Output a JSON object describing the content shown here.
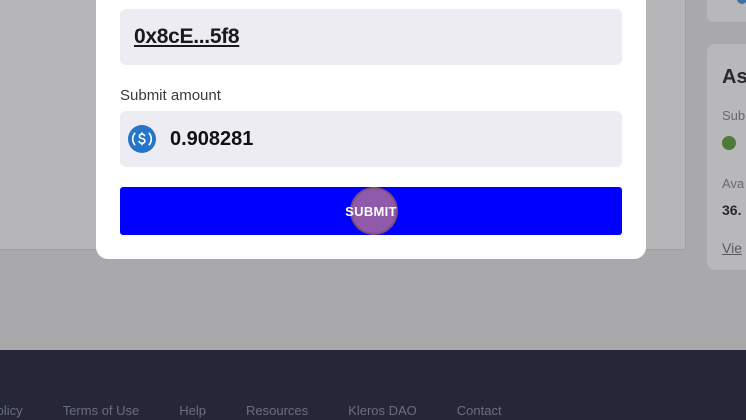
{
  "modal": {
    "address": "0x8cE...5f8",
    "amount_label": "Submit amount",
    "amount_value": "0.908281",
    "submit_label": "SUBMIT"
  },
  "background": {
    "card_title": "As",
    "card_label_1": "Sub",
    "card_label_2": "Ava",
    "card_value": "36.",
    "card_link": "Vie"
  },
  "footer": {
    "links": [
      "Policy",
      "Terms of Use",
      "Help",
      "Resources",
      "Kleros DAO",
      "Contact"
    ]
  },
  "colors": {
    "primary_button": "#0000ff",
    "footer_bg": "#252738",
    "usdc_blue": "#2775ca"
  }
}
